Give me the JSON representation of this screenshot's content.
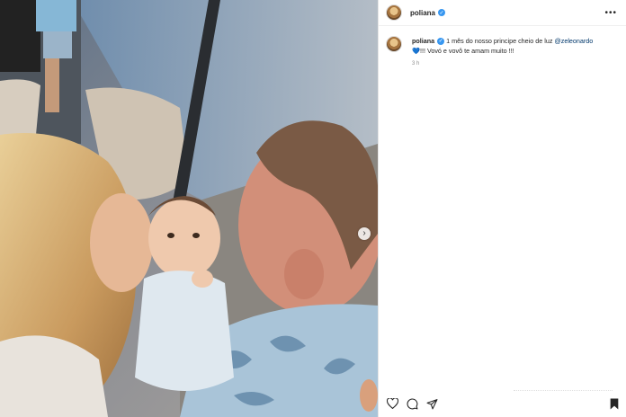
{
  "post": {
    "username": "poliana",
    "caption_user": "poliana",
    "caption_text_1": " 1 mês do nosso principe cheio de luz ",
    "caption_mention": "@zeleonardo",
    "caption_emoji": "💙",
    "caption_text_2": "!!! Vovó e vovô te amam muito !!!",
    "time": "3 h"
  },
  "icons": {
    "verified": "verified-badge-icon",
    "more": "more-options-icon",
    "like": "heart-icon",
    "comment": "comment-icon",
    "share": "send-icon",
    "save": "bookmark-icon",
    "next": "chevron-right-icon"
  },
  "glyphs": {
    "check": "✓",
    "more": "•••",
    "next": "›"
  },
  "colors": {
    "verified": "#3897f0",
    "mention": "#00376b",
    "text": "#262626",
    "muted": "#8e8e8e"
  }
}
